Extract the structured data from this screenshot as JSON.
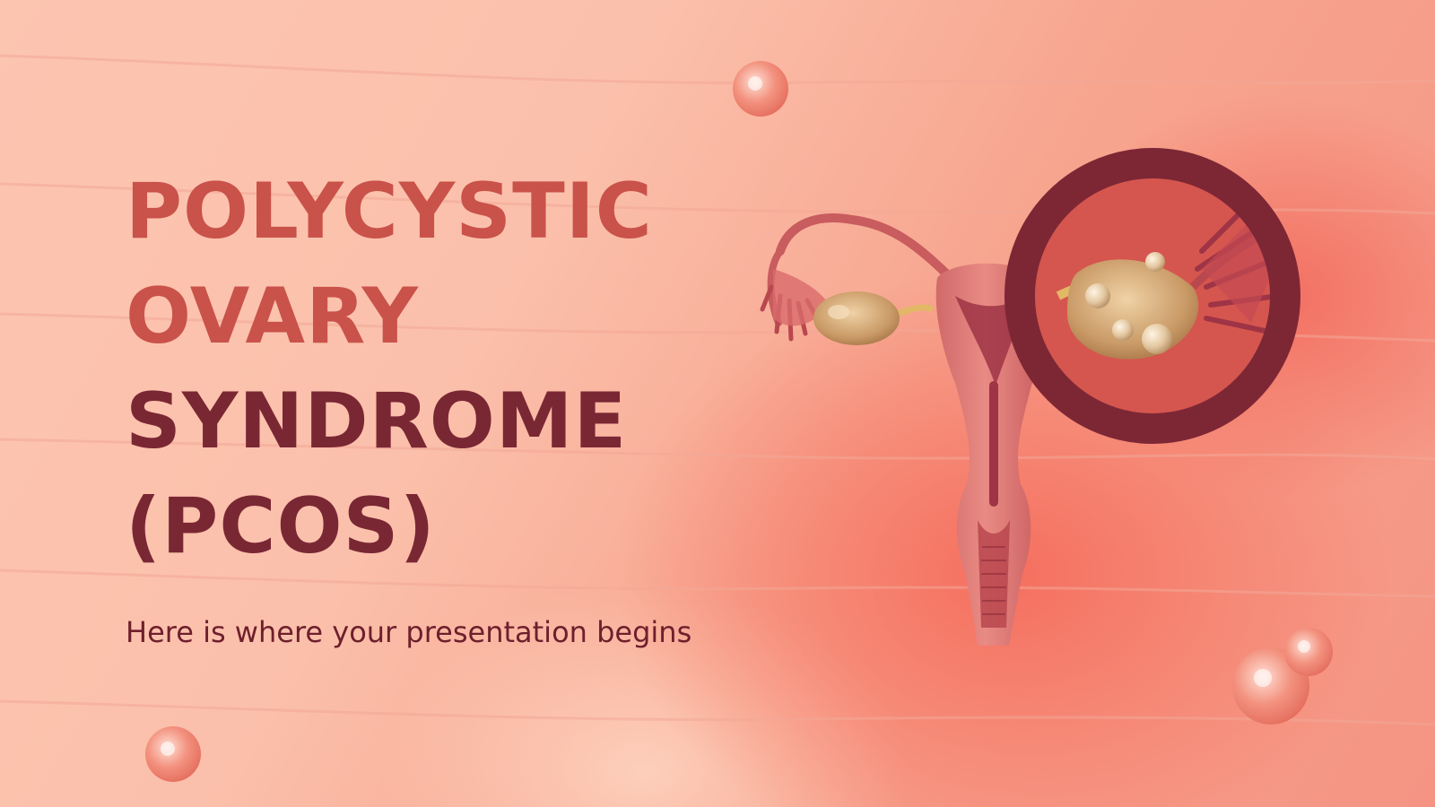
{
  "slide": {
    "title_lines": [
      {
        "text": "POLYCYSTIC",
        "tone": "red"
      },
      {
        "text": "OVARY",
        "tone": "red"
      },
      {
        "text": "SYNDROME",
        "tone": "dark"
      },
      {
        "text": "(PCOS)",
        "tone": "dark"
      }
    ],
    "subtitle": "Here is where your presentation begins"
  },
  "colors": {
    "title_red": "#c9524a",
    "title_dark": "#7a2734",
    "subtitle": "#6e1f2c",
    "magnifier_ring": "#7d2735",
    "background": "#fbc0ab"
  },
  "icons": {
    "illustration": "uterus-ovaries-illustration",
    "magnifier": "magnifier-ovary-cysts-icon",
    "bubbles": "cell-bubble-icon"
  }
}
